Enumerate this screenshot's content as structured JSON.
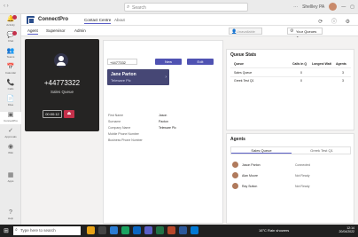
{
  "window": {
    "search_placeholder": "Search",
    "user_label": "Shellley PA",
    "nav_arrows": "‹  ›"
  },
  "rail": {
    "items": [
      {
        "label": "Activity",
        "glyph": "🔔",
        "badge": true
      },
      {
        "label": "Chat",
        "glyph": "💬",
        "badge": true
      },
      {
        "label": "Teams",
        "glyph": "👥",
        "badge": false
      },
      {
        "label": "Calendar",
        "glyph": "📅",
        "badge": false
      },
      {
        "label": "Calls",
        "glyph": "📞",
        "badge": false
      },
      {
        "label": "Files",
        "glyph": "📄",
        "badge": false
      },
      {
        "label": "ConnectPro",
        "glyph": "▣",
        "badge": false
      },
      {
        "label": "Approvals",
        "glyph": "✓",
        "badge": false
      },
      {
        "label": "Wiki",
        "glyph": "◉",
        "badge": false
      },
      {
        "label": "Apps",
        "glyph": "▦",
        "badge": false
      },
      {
        "label": "Help",
        "glyph": "?",
        "badge": false
      }
    ]
  },
  "app": {
    "title": "ConnectPro",
    "tabs": [
      "Contact Centre",
      "About"
    ],
    "header_icons": "⟳ ⓘ ⚙"
  },
  "subnav": {
    "tabs": [
      "Agent",
      "Supervisor",
      "Admin"
    ],
    "availability": "Unavailable",
    "your_queues": "Your Queues"
  },
  "call": {
    "number": "+44773322",
    "queue": "Sales Queue",
    "timer": "00:00:12",
    "hangup_glyph": "⏏"
  },
  "contact": {
    "id_value": "+4477332",
    "new_label": "New",
    "edit_label": "Edit",
    "card_name": "Jane Parton",
    "card_company": "Teleware Plc",
    "fields": [
      {
        "label": "First Name",
        "value": "Jason"
      },
      {
        "label": "Surname",
        "value": "Paxton"
      },
      {
        "label": "Company Name",
        "value": "Teleware Plc"
      },
      {
        "label": "Mobile Phone Number",
        "value": ""
      },
      {
        "label": "Business Phone Number",
        "value": ""
      }
    ]
  },
  "queue_stats": {
    "title": "Queue Stats",
    "columns": [
      "Queue",
      "Calls in Q",
      "Longest Wait",
      "Agents"
    ],
    "rows": [
      {
        "queue": "Sales Queue",
        "calls": "0",
        "wait": "",
        "agents": "3"
      },
      {
        "queue": "Greek Test Q1",
        "calls": "0",
        "wait": "",
        "agents": "3"
      }
    ]
  },
  "agents": {
    "title": "Agents",
    "tabs": [
      "Sales Queue",
      "Greek Test Q1"
    ],
    "list": [
      {
        "name": "Jason Parton",
        "status": "Connected"
      },
      {
        "name": "Alan Moore",
        "status": "Not Ready"
      },
      {
        "name": "Ray Sutton",
        "status": "Not Ready"
      }
    ]
  },
  "taskbar": {
    "search_placeholder": "Type here to search",
    "weather": "16°C  Rain showers",
    "time": "12:14",
    "date": "20/04/2022"
  }
}
